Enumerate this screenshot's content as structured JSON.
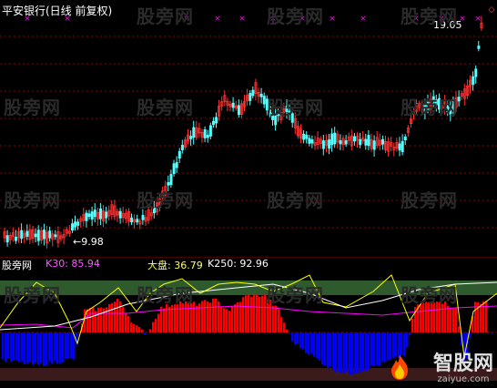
{
  "title": "平安银行(日线 前复权)",
  "watermark": "股旁网",
  "price_high_label": "19.05",
  "price_low_label": "9.98",
  "indicator": {
    "name": "股旁网",
    "k30_label": "K30: 85.94",
    "dapan_label": "大盘: 36.79",
    "k250_label": "K250: 92.96"
  },
  "brand": {
    "name": "智股网",
    "url": "zaiyue.com"
  },
  "colors": {
    "up": "#ff3232",
    "down": "#54ffff",
    "hist_up": "#ff0000",
    "hist_down": "#0000ff",
    "k30": "#ff00ff",
    "dapan": "#ffff00",
    "k250": "#ffffff",
    "grid": "#8b0000",
    "band_top": "#2e5a2e",
    "band_bottom": "#3a1a1a"
  },
  "chart_data": {
    "type": "candlestick",
    "marked_high": 19.05,
    "marked_low": 9.98,
    "indicator_values": {
      "K30": 85.94,
      "大盘": 36.79,
      "K250": 92.96
    }
  }
}
